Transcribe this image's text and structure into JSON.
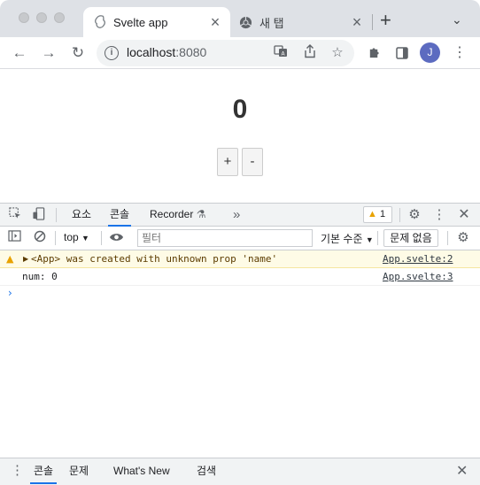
{
  "browser": {
    "tabs": [
      {
        "title": "Svelte app",
        "active": true,
        "icon": "svelte-logo-icon"
      },
      {
        "title": "새 탭",
        "active": false,
        "icon": "chrome-logo-icon"
      }
    ],
    "address": {
      "host": "localhost",
      "port": ":8080"
    },
    "profile_initial": "J"
  },
  "app": {
    "count": "0",
    "increment_label": "+",
    "decrement_label": "-"
  },
  "devtools": {
    "tabs": [
      "요소",
      "콘솔",
      "Recorder"
    ],
    "active_tab": "콘솔",
    "more_tabs_glyph": "»",
    "warning_count": "1",
    "context": "top",
    "filter_placeholder": "필터",
    "levels": "기본 수준",
    "issues_label": "문제 없음",
    "messages": [
      {
        "type": "warning",
        "text": "<App> was created with unknown prop 'name'",
        "source": "App.svelte:2"
      },
      {
        "type": "log",
        "text": "num: 0",
        "source": "App.svelte:3"
      }
    ],
    "prompt": "›",
    "drawer_tabs": [
      "콘솔",
      "문제",
      "What's New",
      "검색"
    ]
  },
  "colors": {
    "accent": "#1a73e8",
    "warning_bg": "#fefbe6",
    "warning_icon": "#e8a200",
    "avatar": "#5c6bc0"
  }
}
